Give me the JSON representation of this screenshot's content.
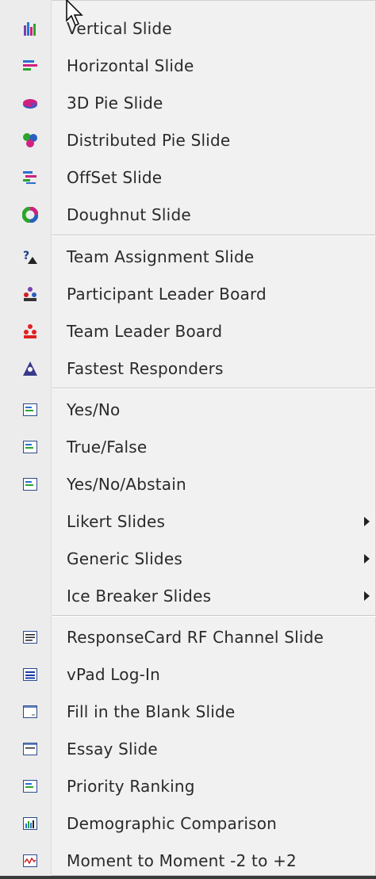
{
  "menu": {
    "charts": [
      {
        "label": "Vertical Slide",
        "icon": "vertical-bar-chart-icon"
      },
      {
        "label": "Horizontal Slide",
        "icon": "horizontal-bar-chart-icon"
      },
      {
        "label": "3D Pie Slide",
        "icon": "3d-pie-icon"
      },
      {
        "label": "Distributed Pie Slide",
        "icon": "distributed-pie-icon"
      },
      {
        "label": "OffSet Slide",
        "icon": "offset-chart-icon"
      },
      {
        "label": "Doughnut Slide",
        "icon": "doughnut-chart-icon"
      }
    ],
    "teams": [
      {
        "label": "Team Assignment Slide",
        "icon": "team-assignment-icon"
      },
      {
        "label": "Participant Leader Board",
        "icon": "participant-leader-icon"
      },
      {
        "label": "Team Leader Board",
        "icon": "team-leader-icon"
      },
      {
        "label": "Fastest Responders",
        "icon": "fastest-responders-icon"
      }
    ],
    "answers": [
      {
        "label": "Yes/No",
        "icon": "slide-icon"
      },
      {
        "label": "True/False",
        "icon": "slide-icon"
      },
      {
        "label": "Yes/No/Abstain",
        "icon": "slide-icon"
      }
    ],
    "submenus": [
      {
        "label": "Likert Slides"
      },
      {
        "label": "Generic Slides"
      },
      {
        "label": "Ice Breaker Slides"
      }
    ],
    "other": [
      {
        "label": "ResponseCard RF Channel Slide",
        "icon": "channel-slide-icon"
      },
      {
        "label": "vPad Log-In",
        "icon": "vpad-login-icon"
      },
      {
        "label": "Fill in the Blank Slide",
        "icon": "fill-blank-icon"
      },
      {
        "label": "Essay Slide",
        "icon": "essay-slide-icon"
      },
      {
        "label": "Priority Ranking",
        "icon": "priority-ranking-icon"
      },
      {
        "label": "Demographic Comparison",
        "icon": "demographic-comparison-icon"
      },
      {
        "label": "Moment to Moment -2 to +2",
        "icon": "moment-to-moment-icon"
      }
    ]
  }
}
